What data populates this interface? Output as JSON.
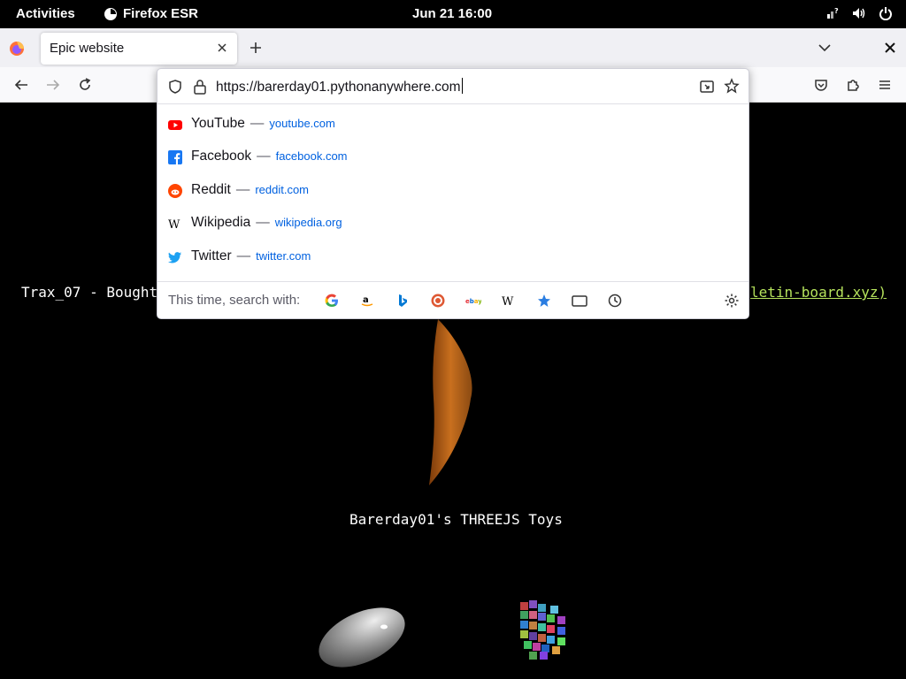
{
  "topbar": {
    "activities": "Activities",
    "app_name": "Firefox ESR",
    "clock": "Jun 21  16:00"
  },
  "browser": {
    "tab_title": "Epic website",
    "url": "https://barerday01.pythonanywhere.com",
    "suggestions": [
      {
        "name": "YouTube",
        "site": "youtube.com",
        "icon": "youtube-icon",
        "color": "#ff0000"
      },
      {
        "name": "Facebook",
        "site": "facebook.com",
        "icon": "facebook-icon",
        "color": "#1877f2"
      },
      {
        "name": "Reddit",
        "site": "reddit.com",
        "icon": "reddit-icon",
        "color": "#ff4500"
      },
      {
        "name": "Wikipedia",
        "site": "wikipedia.org",
        "icon": "wikipedia-icon",
        "color": "#000000"
      },
      {
        "name": "Twitter",
        "site": "twitter.com",
        "icon": "twitter-icon",
        "color": "#1da1f2"
      }
    ],
    "dash": "—",
    "search_with_label": "This time, search with:",
    "search_engines": [
      "google-icon",
      "amazon-icon",
      "bing-icon",
      "duckduckgo-icon",
      "ebay-icon",
      "wikipedia-icon",
      "bookmarks-icon",
      "tabs-icon",
      "history-icon"
    ]
  },
  "page": {
    "left_text": "Trax_07 - Bought",
    "right_link": "letin-board.xyz)",
    "title": "Barerday01's THREEJS Toys"
  },
  "colors": {
    "accent": "#0061e0",
    "link_green": "#b6e35c"
  }
}
